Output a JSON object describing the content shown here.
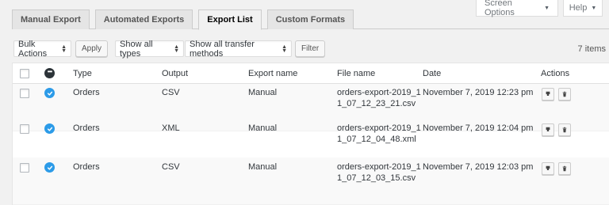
{
  "screen_meta": {
    "screen_options_label": "Screen Options",
    "help_label": "Help",
    "caret": "▼"
  },
  "tabs": [
    {
      "label": "Manual Export",
      "active": false
    },
    {
      "label": "Automated Exports",
      "active": false
    },
    {
      "label": "Export List",
      "active": true
    },
    {
      "label": "Custom Formats",
      "active": false
    }
  ],
  "tablenav": {
    "bulk_actions": "Bulk Actions",
    "apply_label": "Apply",
    "types_filter": "Show all types",
    "methods_filter": "Show all transfer methods",
    "filter_label": "Filter",
    "items_count": "7 items"
  },
  "table": {
    "columns": {
      "type": "Type",
      "output": "Output",
      "export_name": "Export name",
      "file_name": "File name",
      "date": "Date",
      "actions": "Actions"
    },
    "rows": [
      {
        "type": "Orders",
        "output": "CSV",
        "export_name": "Manual",
        "file_name": "orders-export-2019_11_07_12_23_21.csv",
        "date": "November 7, 2019 12:23 pm",
        "status": "completed"
      },
      {
        "type": "Orders",
        "output": "XML",
        "export_name": "Manual",
        "file_name": "orders-export-2019_11_07_12_04_48.xml",
        "date": "November 7, 2019 12:04 pm",
        "status": "completed"
      },
      {
        "type": "Orders",
        "output": "CSV",
        "export_name": "Manual",
        "file_name": "orders-export-2019_11_07_12_03_15.csv",
        "date": "November 7, 2019 12:03 pm",
        "status": "completed"
      }
    ]
  },
  "colors": {
    "status_ok": "#2c9be8",
    "background": "#f1f1f1"
  },
  "icons": {
    "status_header": "more-icon",
    "status_row": "check-icon",
    "action_download": "download-icon",
    "action_delete": "trash-icon"
  }
}
